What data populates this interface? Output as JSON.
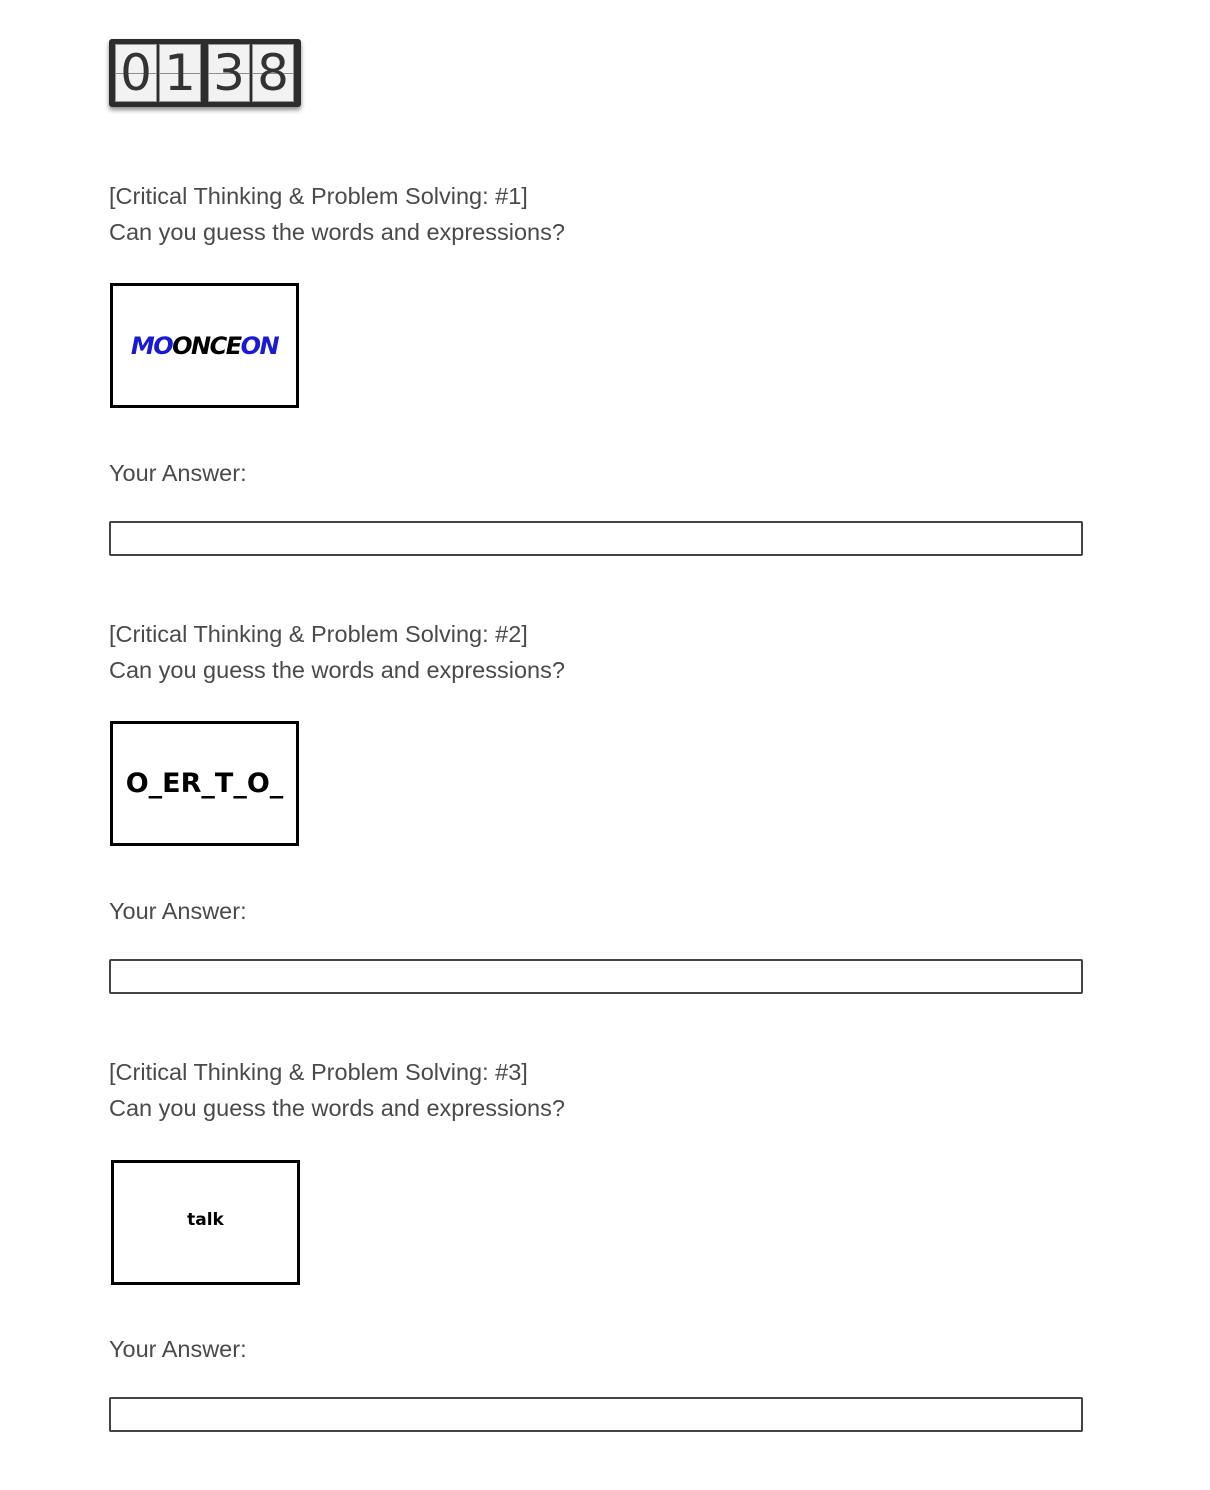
{
  "timer": {
    "digits": [
      "0",
      "1",
      "3",
      "8"
    ]
  },
  "questions": [
    {
      "title": "[Critical Thinking & Problem Solving: #1]",
      "prompt": "Can you guess the words and expressions?",
      "puzzle": {
        "segments": [
          {
            "text": "MO",
            "color": "#1a1ad4"
          },
          {
            "text": "ONCE",
            "color": "#000000"
          },
          {
            "text": "ON",
            "color": "#1a1ad4"
          }
        ]
      },
      "answer_label": "Your Answer:",
      "answer_value": ""
    },
    {
      "title": "[Critical Thinking & Problem Solving: #2]",
      "prompt": "Can you guess the words and expressions?",
      "puzzle": {
        "text": "O_ER_T_O_"
      },
      "answer_label": "Your Answer:",
      "answer_value": ""
    },
    {
      "title": "[Critical Thinking & Problem Solving: #3]",
      "prompt": "Can you guess the words and expressions?",
      "puzzle": {
        "text": "talk"
      },
      "answer_label": "Your Answer:",
      "answer_value": ""
    }
  ],
  "colors": {
    "text": "#4a4a4a",
    "puzzle_blue": "#1a1ad4",
    "timer_bg": "#2d2d2d"
  }
}
